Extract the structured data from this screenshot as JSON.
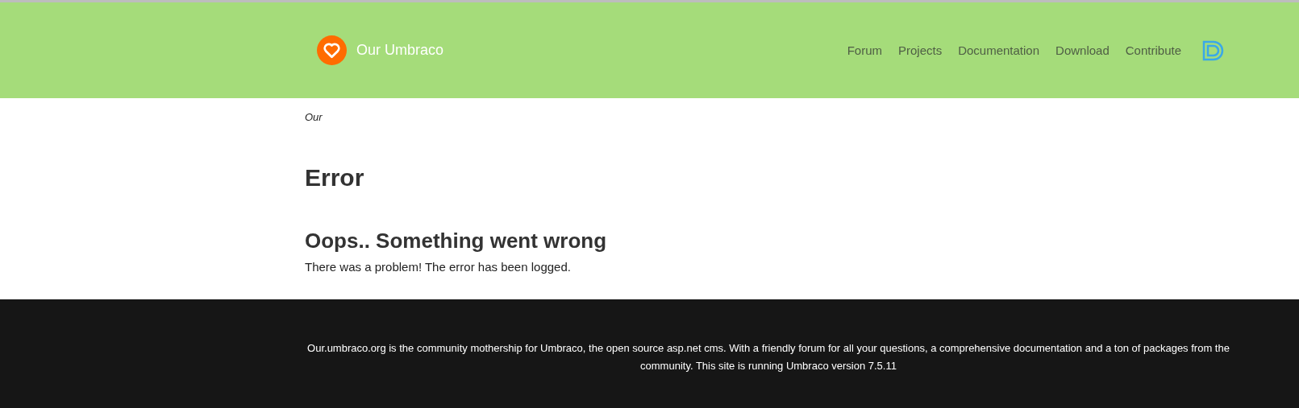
{
  "header": {
    "brand": "Our Umbraco",
    "nav": [
      {
        "label": "Forum"
      },
      {
        "label": "Projects"
      },
      {
        "label": "Documentation"
      },
      {
        "label": "Download"
      },
      {
        "label": "Contribute"
      }
    ]
  },
  "breadcrumb": "Our",
  "title": "Error",
  "subtitle": "Oops.. Something went wrong",
  "message": "There was a problem! The error has been logged.",
  "footer": "Our.umbraco.org is the community mothership for Umbraco, the open source asp.net cms. With a friendly forum for all your questions, a comprehensive documentation and a ton of packages from the community. This site is running Umbraco version 7.5.11"
}
